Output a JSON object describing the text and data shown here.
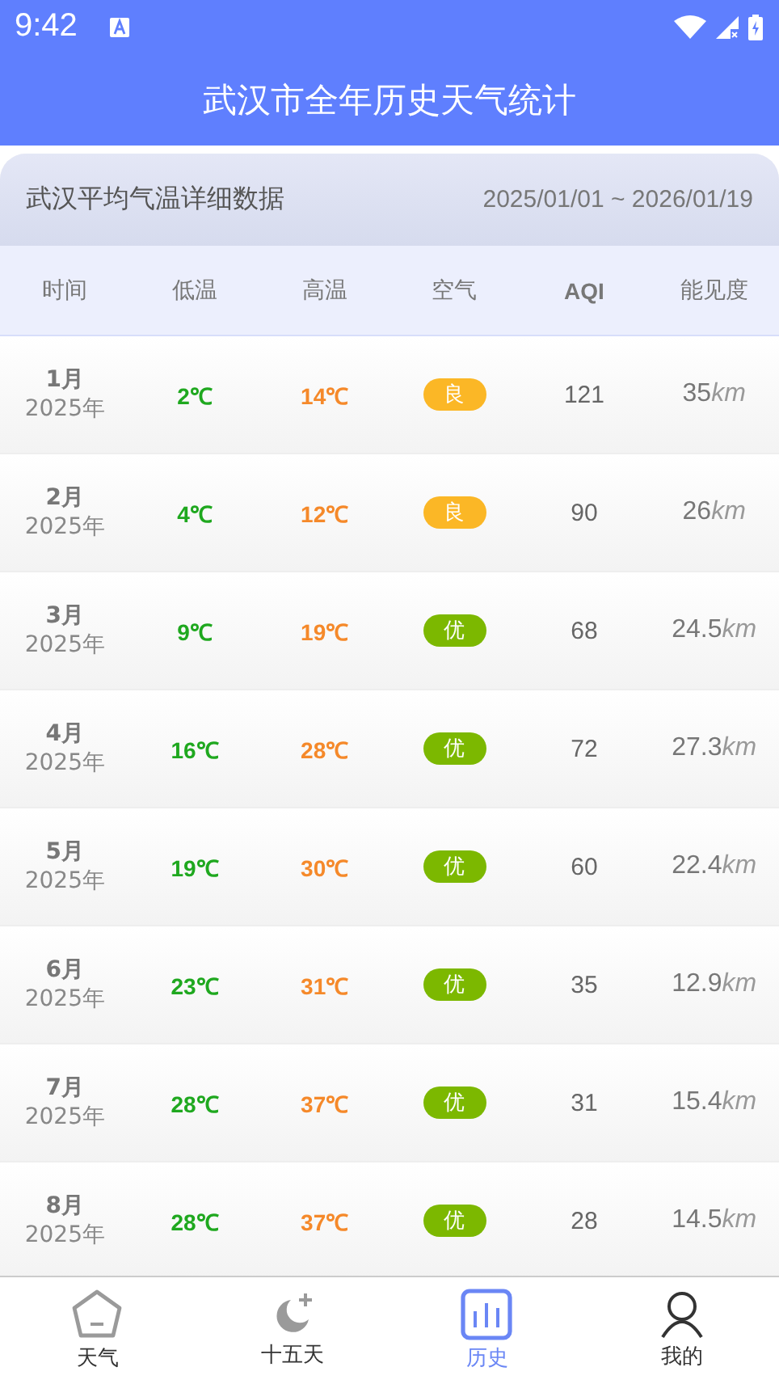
{
  "status_bar": {
    "time": "9:42"
  },
  "app_bar": {
    "title": "武汉市全年历史天气统计"
  },
  "card": {
    "title": "武汉平均气温详细数据",
    "range": "2025/01/01 ~ 2026/01/19"
  },
  "table": {
    "columns": [
      "时间",
      "低温",
      "高温",
      "空气",
      "AQI",
      "能见度"
    ],
    "rows": [
      {
        "month": "1月",
        "year": "2025年",
        "low": "2℃",
        "high": "14℃",
        "air": "良",
        "color": "#fbb726",
        "aqi": "121",
        "visibility": "35",
        "unit": "km"
      },
      {
        "month": "2月",
        "year": "2025年",
        "low": "4℃",
        "high": "12℃",
        "air": "良",
        "color": "#fbb726",
        "aqi": "90",
        "visibility": "26",
        "unit": "km"
      },
      {
        "month": "3月",
        "year": "2025年",
        "low": "9℃",
        "high": "19℃",
        "air": "优",
        "color": "#7cb800",
        "aqi": "68",
        "visibility": "24.5",
        "unit": "km"
      },
      {
        "month": "4月",
        "year": "2025年",
        "low": "16℃",
        "high": "28℃",
        "air": "优",
        "color": "#7cb800",
        "aqi": "72",
        "visibility": "27.3",
        "unit": "km"
      },
      {
        "month": "5月",
        "year": "2025年",
        "low": "19℃",
        "high": "30℃",
        "air": "优",
        "color": "#7cb800",
        "aqi": "60",
        "visibility": "22.4",
        "unit": "km"
      },
      {
        "month": "6月",
        "year": "2025年",
        "low": "23℃",
        "high": "31℃",
        "air": "优",
        "color": "#7cb800",
        "aqi": "35",
        "visibility": "12.9",
        "unit": "km"
      },
      {
        "month": "7月",
        "year": "2025年",
        "low": "28℃",
        "high": "37℃",
        "air": "优",
        "color": "#7cb800",
        "aqi": "31",
        "visibility": "15.4",
        "unit": "km"
      },
      {
        "month": "8月",
        "year": "2025年",
        "low": "28℃",
        "high": "37℃",
        "air": "优",
        "color": "#7cb800",
        "aqi": "28",
        "visibility": "14.5",
        "unit": "km"
      }
    ]
  },
  "tabs": [
    {
      "kind": "home",
      "label": "天气",
      "selected": false
    },
    {
      "kind": "moon",
      "label": "十五天",
      "selected": false
    },
    {
      "kind": "chart",
      "label": "历史",
      "selected": true
    },
    {
      "kind": "person",
      "label": "我的",
      "selected": false
    }
  ]
}
